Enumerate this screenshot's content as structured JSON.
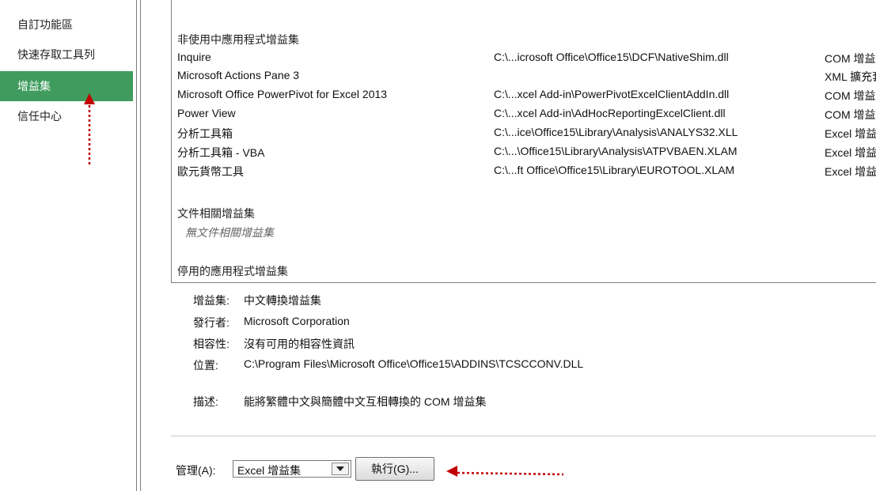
{
  "sidebar": {
    "items": [
      {
        "label": "自訂功能區"
      },
      {
        "label": "快速存取工具列"
      },
      {
        "label": "增益集"
      },
      {
        "label": "信任中心"
      }
    ],
    "active_index": 2
  },
  "addins": {
    "inactive_header": "非使用中應用程式增益集",
    "inactive": [
      {
        "name": "Inquire",
        "location": "C:\\...icrosoft Office\\Office15\\DCF\\NativeShim.dll",
        "type": "COM 增益集"
      },
      {
        "name": "Microsoft Actions Pane 3",
        "location": "",
        "type": "XML 擴充套"
      },
      {
        "name": "Microsoft Office PowerPivot for Excel 2013",
        "location": "C:\\...xcel Add-in\\PowerPivotExcelClientAddIn.dll",
        "type": "COM 增益集"
      },
      {
        "name": "Power View",
        "location": "C:\\...xcel Add-in\\AdHocReportingExcelClient.dll",
        "type": "COM 增益集"
      },
      {
        "name": "分析工具箱",
        "location": "C:\\...ice\\Office15\\Library\\Analysis\\ANALYS32.XLL",
        "type": "Excel 增益集"
      },
      {
        "name": "分析工具箱 - VBA",
        "location": "C:\\...\\Office15\\Library\\Analysis\\ATPVBAEN.XLAM",
        "type": "Excel 增益集"
      },
      {
        "name": "歐元貨幣工具",
        "location": "C:\\...ft Office\\Office15\\Library\\EUROTOOL.XLAM",
        "type": "Excel 增益集"
      }
    ],
    "document_header": "文件相關增益集",
    "document_empty": "無文件相關增益集",
    "disabled_header": "停用的應用程式增益集"
  },
  "details": {
    "addin_label": "增益集:",
    "addin_value": "中文轉換增益集",
    "publisher_label": "發行者:",
    "publisher_value": "Microsoft Corporation",
    "compat_label": "相容性:",
    "compat_value": "沒有可用的相容性資訊",
    "location_label": "位置:",
    "location_value": "C:\\Program Files\\Microsoft Office\\Office15\\ADDINS\\TCSCCONV.DLL",
    "desc_label": "描述:",
    "desc_value": "能將繁體中文與簡體中文互相轉換的 COM 增益集"
  },
  "manage": {
    "label": "管理(A):",
    "selected": "Excel 增益集",
    "go_label": "執行(G)..."
  },
  "colors": {
    "active_sidebar": "#3f9c5e",
    "annotation_arrow": "#c00000"
  }
}
